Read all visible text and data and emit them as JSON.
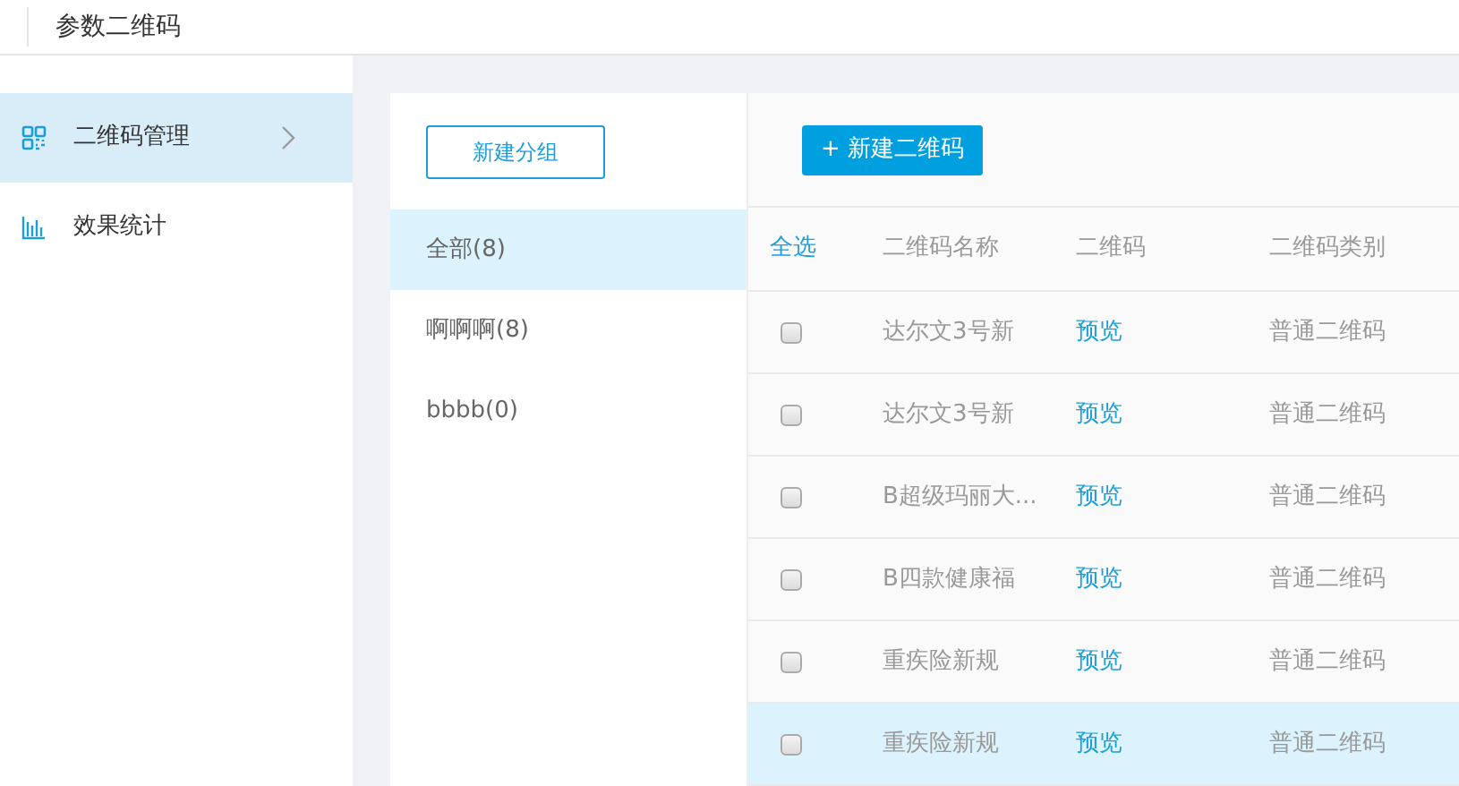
{
  "header": {
    "title": "参数二维码"
  },
  "sidebar": {
    "items": [
      {
        "label": "二维码管理",
        "kind": "grid",
        "selected": true
      },
      {
        "label": "效果统计",
        "kind": "bars",
        "selected": false
      }
    ]
  },
  "groups": {
    "new_button": "新建分组",
    "items": [
      {
        "label": "全部(8)",
        "selected": true
      },
      {
        "label": "啊啊啊(8)",
        "selected": false
      },
      {
        "label": "bbbb(0)",
        "selected": false
      }
    ]
  },
  "table": {
    "new_button": "+ 新建二维码",
    "select_all": "全选",
    "columns": [
      "二维码名称",
      "二维码",
      "二维码类别"
    ],
    "rows": [
      {
        "name": "达尔文3号新",
        "qr": "预览",
        "type": "普通二维码",
        "checked": false,
        "selected": false
      },
      {
        "name": "达尔文3号新",
        "qr": "预览",
        "type": "普通二维码",
        "checked": false,
        "selected": false
      },
      {
        "name": "B超级玛丽大...",
        "qr": "预览",
        "type": "普通二维码",
        "checked": false,
        "selected": false
      },
      {
        "name": "B四款健康福",
        "qr": "预览",
        "type": "普通二维码",
        "checked": false,
        "selected": false
      },
      {
        "name": "重疾险新规",
        "qr": "预览",
        "type": "普通二维码",
        "checked": false,
        "selected": false
      },
      {
        "name": "重疾险新规",
        "qr": "预览",
        "type": "普通二维码",
        "checked": false,
        "selected": true
      }
    ]
  }
}
